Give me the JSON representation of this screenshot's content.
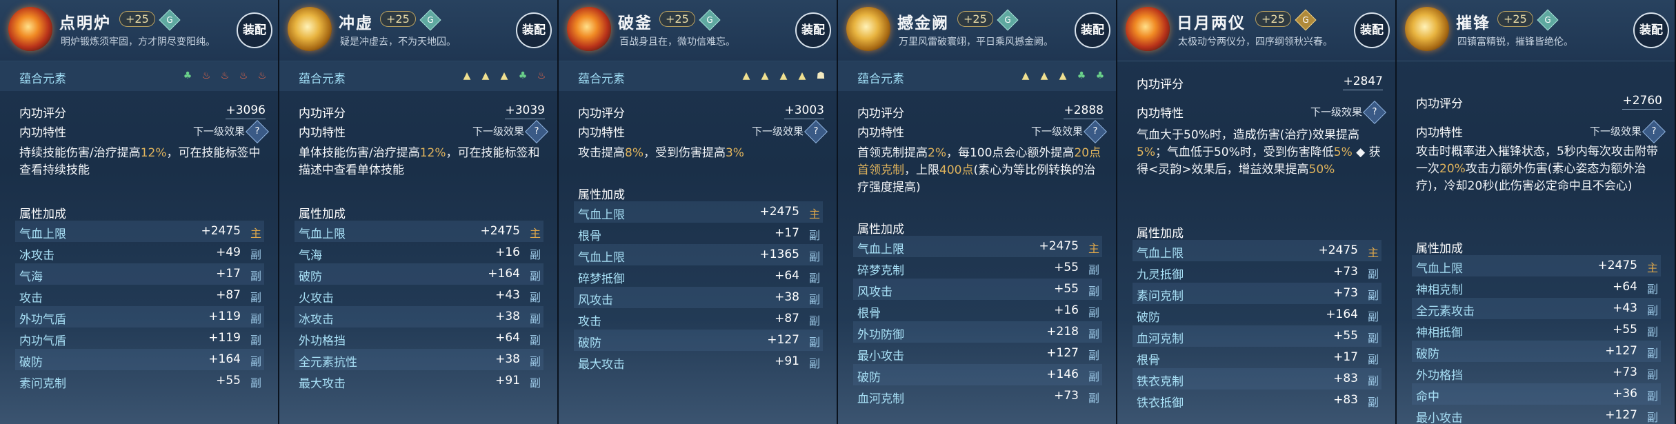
{
  "cards": [
    {
      "name": "点明炉",
      "level": "+25",
      "grade": "G",
      "grade_color": "teal",
      "motto": "明炉锻炼须牢固，方才阴尽变阳纯。",
      "equip": "装配",
      "element_label": "蕴合元素",
      "elements": [
        "wood",
        "fire",
        "fire",
        "fire",
        "fire"
      ],
      "score_label": "内功评分",
      "score": "+3096",
      "trait_label": "内功特性",
      "next_label": "下一级效果",
      "help": "?",
      "desc_parts": [
        {
          "t": "持续技能伤害/治疗提高"
        },
        {
          "t": "12%",
          "hl": true
        },
        {
          "t": "，可在技能标签中查看持续技能"
        }
      ],
      "attr_title": "属性加成",
      "attrs": [
        {
          "name": "气血上限",
          "value": "+2475",
          "tag": "主",
          "main": true
        },
        {
          "name": "冰攻击",
          "value": "+49",
          "tag": "副"
        },
        {
          "name": "气海",
          "value": "+17",
          "tag": "副"
        },
        {
          "name": "攻击",
          "value": "+87",
          "tag": "副"
        },
        {
          "name": "外功气盾",
          "value": "+119",
          "tag": "副"
        },
        {
          "name": "内功气盾",
          "value": "+119",
          "tag": "副"
        },
        {
          "name": "破防",
          "value": "+164",
          "tag": "副"
        },
        {
          "name": "素问克制",
          "value": "+55",
          "tag": "副"
        }
      ]
    },
    {
      "name": "冲虚",
      "level": "+25",
      "grade": "G",
      "grade_color": "teal",
      "motto": "疑是冲虚去，不为天地囚。",
      "equip": "装配",
      "element_label": "蕴合元素",
      "elements": [
        "earth",
        "earth",
        "earth",
        "wood",
        "fire"
      ],
      "score_label": "内功评分",
      "score": "+3039",
      "trait_label": "内功特性",
      "next_label": "下一级效果",
      "help": "?",
      "desc_parts": [
        {
          "t": "单体技能伤害/治疗提高"
        },
        {
          "t": "12%",
          "hl": true
        },
        {
          "t": "，可在技能标签和描述中查看单体技能"
        }
      ],
      "attr_title": "属性加成",
      "attrs": [
        {
          "name": "气血上限",
          "value": "+2475",
          "tag": "主",
          "main": true
        },
        {
          "name": "气海",
          "value": "+16",
          "tag": "副"
        },
        {
          "name": "破防",
          "value": "+164",
          "tag": "副"
        },
        {
          "name": "火攻击",
          "value": "+43",
          "tag": "副"
        },
        {
          "name": "冰攻击",
          "value": "+38",
          "tag": "副"
        },
        {
          "name": "外功格挡",
          "value": "+64",
          "tag": "副"
        },
        {
          "name": "全元素抗性",
          "value": "+38",
          "tag": "副"
        },
        {
          "name": "最大攻击",
          "value": "+91",
          "tag": "副"
        }
      ]
    },
    {
      "name": "破釜",
      "level": "+25",
      "grade": "G",
      "grade_color": "teal",
      "motto": "百战身且在，微功信难忘。",
      "equip": "装配",
      "element_label": "蕴合元素",
      "elements": [
        "earth",
        "earth",
        "earth",
        "earth",
        "metal"
      ],
      "score_label": "内功评分",
      "score": "+3003",
      "trait_label": "内功特性",
      "next_label": "下一级效果",
      "help": "?",
      "desc_parts": [
        {
          "t": "攻击提高"
        },
        {
          "t": "8%",
          "hl": true
        },
        {
          "t": "，受到伤害提高"
        },
        {
          "t": "3%",
          "hl": true
        }
      ],
      "attr_title": "属性加成",
      "attrs": [
        {
          "name": "气血上限",
          "value": "+2475",
          "tag": "主",
          "main": true
        },
        {
          "name": "根骨",
          "value": "+17",
          "tag": "副"
        },
        {
          "name": "气血上限",
          "value": "+1365",
          "tag": "副"
        },
        {
          "name": "碎梦抵御",
          "value": "+64",
          "tag": "副"
        },
        {
          "name": "风攻击",
          "value": "+38",
          "tag": "副"
        },
        {
          "name": "攻击",
          "value": "+87",
          "tag": "副"
        },
        {
          "name": "破防",
          "value": "+127",
          "tag": "副"
        },
        {
          "name": "最大攻击",
          "value": "+91",
          "tag": "副"
        }
      ]
    },
    {
      "name": "撼金阙",
      "level": "+25",
      "grade": "G",
      "grade_color": "teal",
      "motto": "万里风雷破寰翊，平日乘风撼金阙。",
      "equip": "装配",
      "element_label": "蕴合元素",
      "elements": [
        "earth",
        "earth",
        "earth",
        "wood",
        "wood"
      ],
      "score_label": "内功评分",
      "score": "+2888",
      "trait_label": "内功特性",
      "next_label": "下一级效果",
      "help": "?",
      "desc_parts": [
        {
          "t": "首领克制提高"
        },
        {
          "t": "2%",
          "hl": true
        },
        {
          "t": "，每100点会心额外提高"
        },
        {
          "t": "20点首领克制",
          "hl": true
        },
        {
          "t": "，上限"
        },
        {
          "t": "400点",
          "hl": true
        },
        {
          "t": "(素心为等比例转换的治疗强度提高)"
        }
      ],
      "attr_title": "属性加成",
      "attrs": [
        {
          "name": "气血上限",
          "value": "+2475",
          "tag": "主",
          "main": true
        },
        {
          "name": "碎梦克制",
          "value": "+55",
          "tag": "副"
        },
        {
          "name": "风攻击",
          "value": "+55",
          "tag": "副"
        },
        {
          "name": "根骨",
          "value": "+16",
          "tag": "副"
        },
        {
          "name": "外功防御",
          "value": "+218",
          "tag": "副"
        },
        {
          "name": "最小攻击",
          "value": "+127",
          "tag": "副"
        },
        {
          "name": "破防",
          "value": "+146",
          "tag": "副"
        },
        {
          "name": "血河克制",
          "value": "+73",
          "tag": "副"
        }
      ]
    },
    {
      "name": "日月两仪",
      "level": "+25",
      "grade": "G",
      "grade_color": "gold",
      "motto": "太极动兮两仪分，四序纲领秋兴春。",
      "equip": "装配",
      "score_label": "内功评分",
      "score": "+2847",
      "trait_label": "内功特性",
      "next_label": "下一级效果",
      "help": "?",
      "desc_parts": [
        {
          "t": "气血大于50%时，造成伤害(治疗)效果提高"
        },
        {
          "t": "5%",
          "hl": true
        },
        {
          "t": "；气血低于50%时，受到伤害降低"
        },
        {
          "t": "5%",
          "hl": true
        },
        {
          "t": " ◆ 获得<灵韵>效果后，增益效果提高"
        },
        {
          "t": "50%",
          "hl": true
        }
      ],
      "attr_title": "属性加成",
      "attrs": [
        {
          "name": "气血上限",
          "value": "+2475",
          "tag": "主",
          "main": true
        },
        {
          "name": "九灵抵御",
          "value": "+73",
          "tag": "副"
        },
        {
          "name": "素问克制",
          "value": "+73",
          "tag": "副"
        },
        {
          "name": "破防",
          "value": "+164",
          "tag": "副"
        },
        {
          "name": "血河克制",
          "value": "+55",
          "tag": "副"
        },
        {
          "name": "根骨",
          "value": "+17",
          "tag": "副"
        },
        {
          "name": "铁衣克制",
          "value": "+83",
          "tag": "副"
        },
        {
          "name": "铁衣抵御",
          "value": "+83",
          "tag": "副"
        }
      ]
    },
    {
      "name": "摧锋",
      "level": "+25",
      "grade": "G",
      "grade_color": "teal",
      "motto": "四镇富精锐，摧锋皆绝伦。",
      "equip": "装配",
      "score_label": "内功评分",
      "score": "+2760",
      "trait_label": "内功特性",
      "next_label": "下一级效果",
      "help": "?",
      "desc_parts": [
        {
          "t": "攻击时概率进入摧锋状态，5秒内每次攻击附带一次"
        },
        {
          "t": "20%",
          "hl": true
        },
        {
          "t": "攻击力额外伤害(素心姿态为额外治疗)，冷却20秒(此伤害必定命中且不会心)"
        }
      ],
      "attr_title": "属性加成",
      "attrs": [
        {
          "name": "气血上限",
          "value": "+2475",
          "tag": "主",
          "main": true
        },
        {
          "name": "神相克制",
          "value": "+64",
          "tag": "副"
        },
        {
          "name": "全元素攻击",
          "value": "+43",
          "tag": "副"
        },
        {
          "name": "神相抵御",
          "value": "+55",
          "tag": "副"
        },
        {
          "name": "破防",
          "value": "+127",
          "tag": "副"
        },
        {
          "name": "外功格挡",
          "value": "+73",
          "tag": "副"
        },
        {
          "name": "命中",
          "value": "+36",
          "tag": "副"
        },
        {
          "name": "最小攻击",
          "value": "+127",
          "tag": "副"
        }
      ]
    }
  ]
}
